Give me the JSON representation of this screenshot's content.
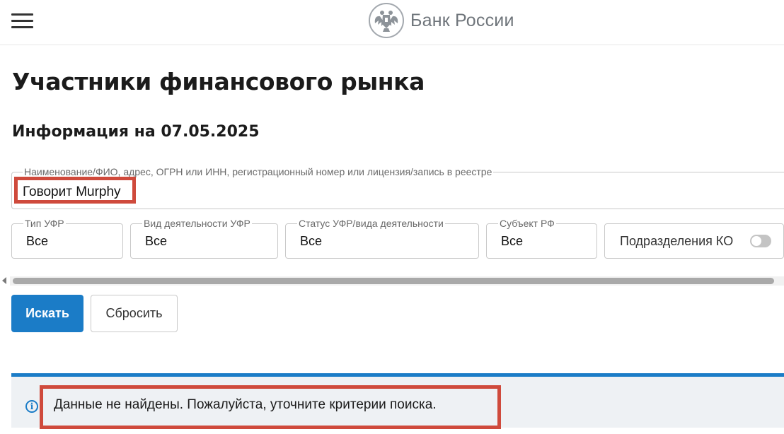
{
  "header": {
    "brand_name": "Банк России",
    "menu_icon": "hamburger-menu-icon",
    "emblem_icon": "double-headed-eagle-emblem"
  },
  "page": {
    "title": "Участники финансового рынка",
    "info_date": "Информация на 07.05.2025"
  },
  "search": {
    "label": "Наименование/ФИО, адрес, ОГРН или ИНН, регистрационный номер или лицензия/запись в реестре",
    "value": "Говорит Murphy"
  },
  "filters": [
    {
      "label": "Тип УФР",
      "value": "Все"
    },
    {
      "label": "Вид деятельности УФР",
      "value": "Все"
    },
    {
      "label": "Статус УФР/вида деятельности",
      "value": "Все"
    },
    {
      "label": "Субъект РФ",
      "value": "Все"
    }
  ],
  "ko_toggle": {
    "label": "Подразделения КО",
    "enabled": false
  },
  "actions": {
    "search_label": "Искать",
    "reset_label": "Сбросить"
  },
  "message": {
    "text": "Данные не найдены. Пожалуйста, уточните критерии поиска.",
    "icon": "info-icon"
  },
  "colors": {
    "accent": "#1b7cc7",
    "highlight": "#cf4a3c",
    "message_bg": "#eef1f4"
  }
}
